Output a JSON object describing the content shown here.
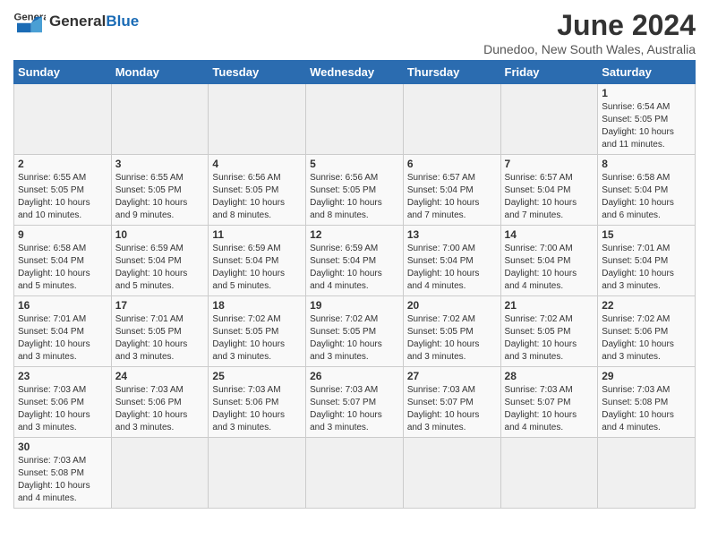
{
  "header": {
    "logo_general": "General",
    "logo_blue": "Blue",
    "month": "June 2024",
    "location": "Dunedoo, New South Wales, Australia"
  },
  "days_of_week": [
    "Sunday",
    "Monday",
    "Tuesday",
    "Wednesday",
    "Thursday",
    "Friday",
    "Saturday"
  ],
  "weeks": [
    [
      {
        "day": "",
        "info": ""
      },
      {
        "day": "",
        "info": ""
      },
      {
        "day": "",
        "info": ""
      },
      {
        "day": "",
        "info": ""
      },
      {
        "day": "",
        "info": ""
      },
      {
        "day": "",
        "info": ""
      },
      {
        "day": "1",
        "info": "Sunrise: 6:54 AM\nSunset: 5:05 PM\nDaylight: 10 hours\nand 11 minutes."
      }
    ],
    [
      {
        "day": "2",
        "info": "Sunrise: 6:55 AM\nSunset: 5:05 PM\nDaylight: 10 hours\nand 10 minutes."
      },
      {
        "day": "3",
        "info": "Sunrise: 6:55 AM\nSunset: 5:05 PM\nDaylight: 10 hours\nand 9 minutes."
      },
      {
        "day": "4",
        "info": "Sunrise: 6:56 AM\nSunset: 5:05 PM\nDaylight: 10 hours\nand 8 minutes."
      },
      {
        "day": "5",
        "info": "Sunrise: 6:56 AM\nSunset: 5:05 PM\nDaylight: 10 hours\nand 8 minutes."
      },
      {
        "day": "6",
        "info": "Sunrise: 6:57 AM\nSunset: 5:04 PM\nDaylight: 10 hours\nand 7 minutes."
      },
      {
        "day": "7",
        "info": "Sunrise: 6:57 AM\nSunset: 5:04 PM\nDaylight: 10 hours\nand 7 minutes."
      },
      {
        "day": "8",
        "info": "Sunrise: 6:58 AM\nSunset: 5:04 PM\nDaylight: 10 hours\nand 6 minutes."
      }
    ],
    [
      {
        "day": "9",
        "info": "Sunrise: 6:58 AM\nSunset: 5:04 PM\nDaylight: 10 hours\nand 5 minutes."
      },
      {
        "day": "10",
        "info": "Sunrise: 6:59 AM\nSunset: 5:04 PM\nDaylight: 10 hours\nand 5 minutes."
      },
      {
        "day": "11",
        "info": "Sunrise: 6:59 AM\nSunset: 5:04 PM\nDaylight: 10 hours\nand 5 minutes."
      },
      {
        "day": "12",
        "info": "Sunrise: 6:59 AM\nSunset: 5:04 PM\nDaylight: 10 hours\nand 4 minutes."
      },
      {
        "day": "13",
        "info": "Sunrise: 7:00 AM\nSunset: 5:04 PM\nDaylight: 10 hours\nand 4 minutes."
      },
      {
        "day": "14",
        "info": "Sunrise: 7:00 AM\nSunset: 5:04 PM\nDaylight: 10 hours\nand 4 minutes."
      },
      {
        "day": "15",
        "info": "Sunrise: 7:01 AM\nSunset: 5:04 PM\nDaylight: 10 hours\nand 3 minutes."
      }
    ],
    [
      {
        "day": "16",
        "info": "Sunrise: 7:01 AM\nSunset: 5:04 PM\nDaylight: 10 hours\nand 3 minutes."
      },
      {
        "day": "17",
        "info": "Sunrise: 7:01 AM\nSunset: 5:05 PM\nDaylight: 10 hours\nand 3 minutes."
      },
      {
        "day": "18",
        "info": "Sunrise: 7:02 AM\nSunset: 5:05 PM\nDaylight: 10 hours\nand 3 minutes."
      },
      {
        "day": "19",
        "info": "Sunrise: 7:02 AM\nSunset: 5:05 PM\nDaylight: 10 hours\nand 3 minutes."
      },
      {
        "day": "20",
        "info": "Sunrise: 7:02 AM\nSunset: 5:05 PM\nDaylight: 10 hours\nand 3 minutes."
      },
      {
        "day": "21",
        "info": "Sunrise: 7:02 AM\nSunset: 5:05 PM\nDaylight: 10 hours\nand 3 minutes."
      },
      {
        "day": "22",
        "info": "Sunrise: 7:02 AM\nSunset: 5:06 PM\nDaylight: 10 hours\nand 3 minutes."
      }
    ],
    [
      {
        "day": "23",
        "info": "Sunrise: 7:03 AM\nSunset: 5:06 PM\nDaylight: 10 hours\nand 3 minutes."
      },
      {
        "day": "24",
        "info": "Sunrise: 7:03 AM\nSunset: 5:06 PM\nDaylight: 10 hours\nand 3 minutes."
      },
      {
        "day": "25",
        "info": "Sunrise: 7:03 AM\nSunset: 5:06 PM\nDaylight: 10 hours\nand 3 minutes."
      },
      {
        "day": "26",
        "info": "Sunrise: 7:03 AM\nSunset: 5:07 PM\nDaylight: 10 hours\nand 3 minutes."
      },
      {
        "day": "27",
        "info": "Sunrise: 7:03 AM\nSunset: 5:07 PM\nDaylight: 10 hours\nand 3 minutes."
      },
      {
        "day": "28",
        "info": "Sunrise: 7:03 AM\nSunset: 5:07 PM\nDaylight: 10 hours\nand 4 minutes."
      },
      {
        "day": "29",
        "info": "Sunrise: 7:03 AM\nSunset: 5:08 PM\nDaylight: 10 hours\nand 4 minutes."
      }
    ],
    [
      {
        "day": "30",
        "info": "Sunrise: 7:03 AM\nSunset: 5:08 PM\nDaylight: 10 hours\nand 4 minutes."
      },
      {
        "day": "",
        "info": ""
      },
      {
        "day": "",
        "info": ""
      },
      {
        "day": "",
        "info": ""
      },
      {
        "day": "",
        "info": ""
      },
      {
        "day": "",
        "info": ""
      },
      {
        "day": "",
        "info": ""
      }
    ]
  ]
}
